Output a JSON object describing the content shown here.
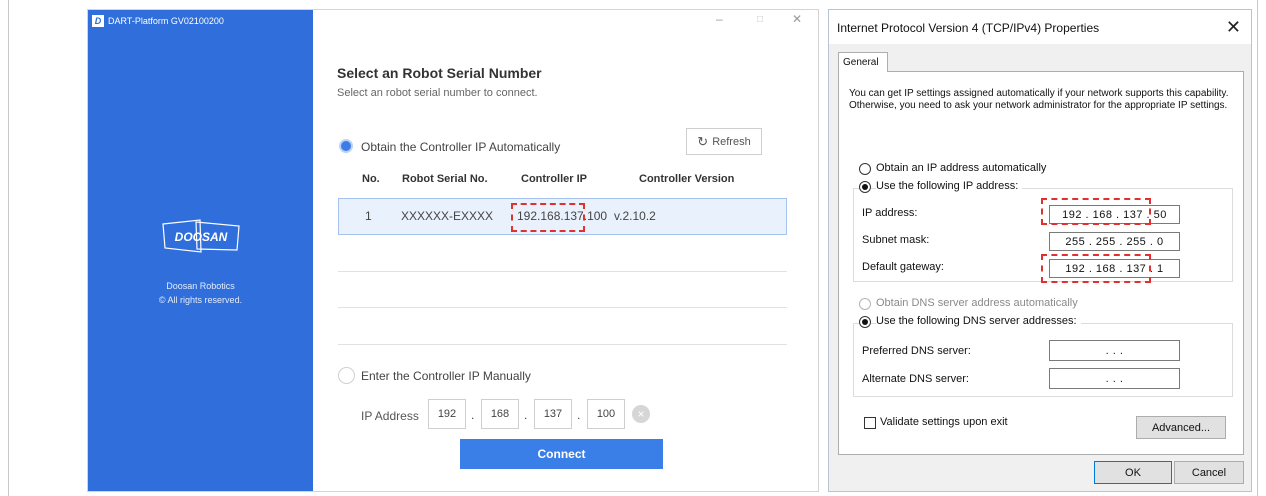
{
  "dart": {
    "window_title": "DART-Platform GV02100200",
    "logo_letter": "D",
    "brand_logo_text": "DOOSAN",
    "brand_name": "Doosan Robotics",
    "copyright": "© All rights reserved.",
    "minimize_glyph": "–",
    "maximize_glyph": "□",
    "close_glyph": "✕",
    "heading": "Select an Robot Serial Number",
    "subheading": "Select an robot serial number to connect.",
    "auto_option_label": "Obtain the Controller IP Automatically",
    "refresh_label": "Refresh",
    "table": {
      "headers": [
        "No.",
        "Robot Serial No.",
        "Controller IP",
        "Controller Version"
      ],
      "rows": [
        {
          "no": "1",
          "serial": "XXXXXX-EXXXX",
          "ip": "192.168.137.100",
          "version": "v.2.10.2"
        }
      ]
    },
    "manual_option_label": "Enter the Controller IP Manually",
    "ip_address_label": "IP Address",
    "ip_octets": [
      "192",
      "168",
      "137",
      "100"
    ],
    "ip_separator": ".",
    "clear_glyph": "×",
    "connect_label": "Connect",
    "accent_color": "#2f6edb"
  },
  "ipv4": {
    "title": "Internet Protocol Version 4 (TCP/IPv4) Properties",
    "close_glyph": "✕",
    "tab_general": "General",
    "info_text": "You can get IP settings assigned automatically if your network supports this capability. Otherwise, you need to ask your network administrator for the appropriate IP settings.",
    "auto_ip_label": "Obtain an IP address automatically",
    "use_ip_label": "Use the following IP address:",
    "ip_address_label": "IP address:",
    "ip_address_value": "192 . 168 . 137 . 50",
    "subnet_label": "Subnet mask:",
    "subnet_value": "255 . 255 . 255 . 0",
    "gateway_label": "Default gateway:",
    "gateway_value": "192 . 168 . 137 . 1",
    "auto_dns_label": "Obtain DNS server address automatically",
    "use_dns_label": "Use the following DNS server addresses:",
    "preferred_dns_label": "Preferred DNS server:",
    "preferred_dns_value": " .  .  . ",
    "alternate_dns_label": "Alternate DNS server:",
    "alternate_dns_value": " .  .  . ",
    "validate_label": "Validate settings upon exit",
    "advanced_label": "Advanced...",
    "ok_label": "OK",
    "cancel_label": "Cancel"
  }
}
